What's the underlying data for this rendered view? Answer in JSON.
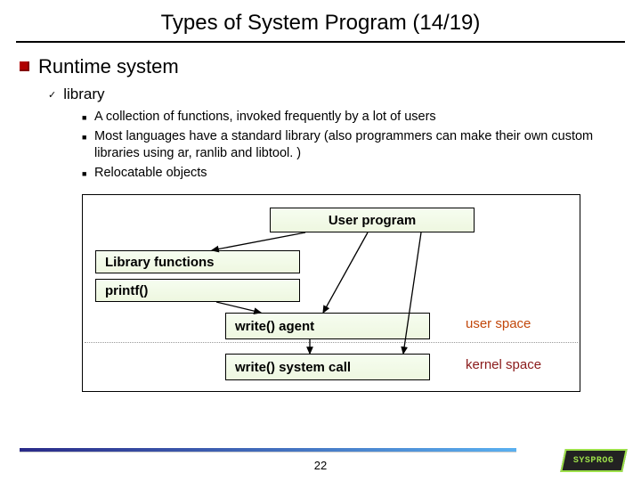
{
  "title": "Types of System Program (14/19)",
  "lvl1": {
    "text": "Runtime system"
  },
  "lvl2": {
    "text": "library"
  },
  "bullets": [
    "A collection of functions, invoked frequently by a lot of users",
    "Most languages have a standard library (also programmers can make their own custom libraries using ar, ranlib and libtool. )",
    "Relocatable objects"
  ],
  "diagram": {
    "user_program": "User program",
    "library_functions": "Library functions",
    "printf": "printf()",
    "write_agent": "write() agent",
    "write_syscall": "write() system call",
    "user_space": "user space",
    "kernel_space": "kernel space"
  },
  "page_number": "22",
  "logo_text": "SYSPROG"
}
